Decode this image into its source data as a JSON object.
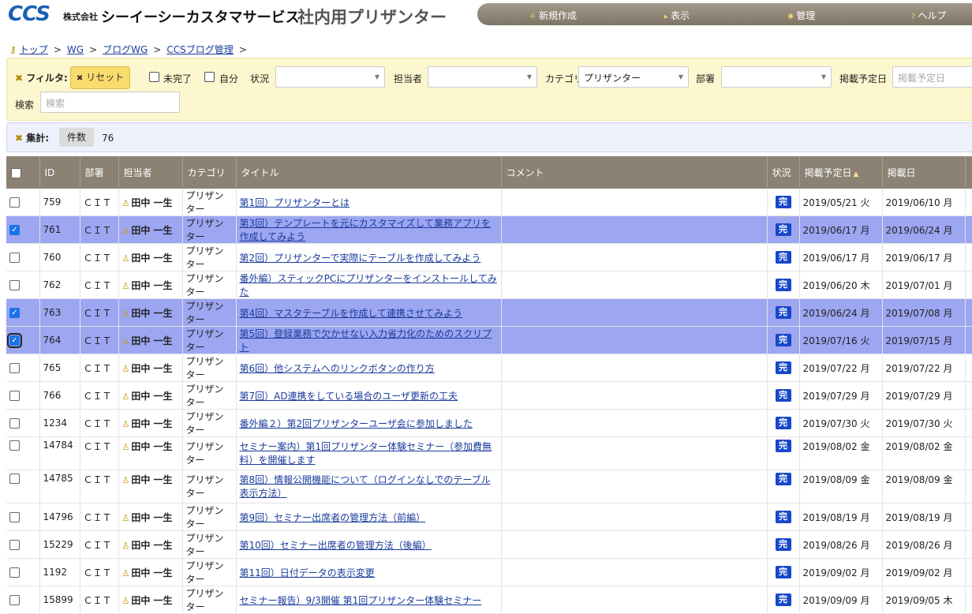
{
  "header": {
    "logo": "CCS",
    "company_prefix": "株式会社",
    "company_name": "シーイーシーカスタマサービス",
    "app_title": "社内用プリザンター",
    "nav": [
      {
        "label": "新規作成",
        "icon": "plus-icon"
      },
      {
        "label": "表示",
        "icon": "arrow-right-icon"
      },
      {
        "label": "管理",
        "icon": "gear-icon"
      },
      {
        "label": "ヘルプ",
        "icon": "question-icon"
      }
    ]
  },
  "breadcrumb": [
    "トップ",
    "WG",
    "ブログWG",
    "CCSブログ管理"
  ],
  "filter": {
    "label": "フィルタ:",
    "reset_label": "リセット",
    "incomplete_label": "未完了",
    "mine_label": "自分",
    "status_label": "状況",
    "status_value": "",
    "owner_label": "担当者",
    "owner_value": "",
    "category_label": "カテゴリ",
    "category_value": "プリザンター",
    "dept_label": "部署",
    "dept_value": "",
    "publish_label": "掲載予定日",
    "publish_placeholder": "掲載予定日",
    "search_label": "検索",
    "search_placeholder": "検索"
  },
  "summary": {
    "label": "集計:",
    "count_label": "件数",
    "count_value": "76"
  },
  "table": {
    "columns": [
      "ID",
      "部署",
      "担当者",
      "カテゴリ",
      "タイトル",
      "コメント",
      "状況",
      "掲載予定日",
      "掲載日"
    ],
    "rows": [
      {
        "id": "759",
        "dept": "ＣＩＴ",
        "owner": "田中 一生",
        "cat": "プリザンター",
        "title": "第1回）プリザンターとは",
        "status": "完",
        "plan": "2019/05/21 火",
        "pub": "2019/06/10 月",
        "checked": false,
        "tall": false
      },
      {
        "id": "761",
        "dept": "ＣＩＴ",
        "owner": "田中 一生",
        "cat": "プリザンター",
        "title": "第3回）テンプレートを元にカスタマイズして業務アプリを作成してみよう",
        "status": "完",
        "plan": "2019/06/17 月",
        "pub": "2019/06/24 月",
        "checked": true,
        "tall": false
      },
      {
        "id": "760",
        "dept": "ＣＩＴ",
        "owner": "田中 一生",
        "cat": "プリザンター",
        "title": "第2回）プリザンターで実際にテーブルを作成してみよう",
        "status": "完",
        "plan": "2019/06/17 月",
        "pub": "2019/06/17 月",
        "checked": false,
        "tall": false
      },
      {
        "id": "762",
        "dept": "ＣＩＴ",
        "owner": "田中 一生",
        "cat": "プリザンター",
        "title": "番外編）スティックPCにプリザンターをインストールしてみた",
        "status": "完",
        "plan": "2019/06/20 木",
        "pub": "2019/07/01 月",
        "checked": false,
        "tall": false
      },
      {
        "id": "763",
        "dept": "ＣＩＴ",
        "owner": "田中 一生",
        "cat": "プリザンター",
        "title": "第4回）マスタテーブルを作成して連携させてみよう",
        "status": "完",
        "plan": "2019/06/24 月",
        "pub": "2019/07/08 月",
        "checked": true,
        "tall": false
      },
      {
        "id": "764",
        "dept": "ＣＩＴ",
        "owner": "田中 一生",
        "cat": "プリザンター",
        "title": "第5回）登録業務で欠かせない入力省力化のためのスクリプト",
        "status": "完",
        "plan": "2019/07/16 火",
        "pub": "2019/07/15 月",
        "checked": true,
        "tall": false
      },
      {
        "id": "765",
        "dept": "ＣＩＴ",
        "owner": "田中 一生",
        "cat": "プリザンター",
        "title": "第6回）他システムへのリンクボタンの作り方",
        "status": "完",
        "plan": "2019/07/22 月",
        "pub": "2019/07/22 月",
        "checked": false,
        "tall": false
      },
      {
        "id": "766",
        "dept": "ＣＩＴ",
        "owner": "田中 一生",
        "cat": "プリザンター",
        "title": "第7回）AD連携をしている場合のユーザ更新の工夫",
        "status": "完",
        "plan": "2019/07/29 月",
        "pub": "2019/07/29 月",
        "checked": false,
        "tall": false
      },
      {
        "id": "1234",
        "dept": "ＣＩＴ",
        "owner": "田中 一生",
        "cat": "プリザンター",
        "title": "番外編２）第2回プリザンターユーザ会に参加しました",
        "status": "完",
        "plan": "2019/07/30 火",
        "pub": "2019/07/30 火",
        "checked": false,
        "tall": false
      },
      {
        "id": "14784",
        "dept": "ＣＩＴ",
        "owner": "田中 一生",
        "cat": "プリザンター",
        "title": "セミナー案内）第1回プリザンター体験セミナー（参加費無料）を開催します",
        "status": "完",
        "plan": "2019/08/02 金",
        "pub": "2019/08/02 金",
        "checked": false,
        "tall": true
      },
      {
        "id": "14785",
        "dept": "ＣＩＴ",
        "owner": "田中 一生",
        "cat": "プリザンター",
        "title": "第8回）情報公開機能について（ログインなしでのテーブル表示方法）",
        "status": "完",
        "plan": "2019/08/09 金",
        "pub": "2019/08/09 金",
        "checked": false,
        "tall": true
      },
      {
        "id": "14796",
        "dept": "ＣＩＴ",
        "owner": "田中 一生",
        "cat": "プリザンター",
        "title": "第9回）セミナー出席者の管理方法（前編）",
        "status": "完",
        "plan": "2019/08/19 月",
        "pub": "2019/08/19 月",
        "checked": false,
        "tall": false
      },
      {
        "id": "15229",
        "dept": "ＣＩＴ",
        "owner": "田中 一生",
        "cat": "プリザンター",
        "title": "第10回）セミナー出席者の管理方法（後編）",
        "status": "完",
        "plan": "2019/08/26 月",
        "pub": "2019/08/26 月",
        "checked": false,
        "tall": false
      },
      {
        "id": "1192",
        "dept": "ＣＩＴ",
        "owner": "田中 一生",
        "cat": "プリザンター",
        "title": "第11回）日付データの表示変更",
        "status": "完",
        "plan": "2019/09/02 月",
        "pub": "2019/09/02 月",
        "checked": false,
        "tall": false
      },
      {
        "id": "15899",
        "dept": "ＣＩＴ",
        "owner": "田中 一生",
        "cat": "プリザンター",
        "title": "セミナー報告）9/3開催 第1回プリザンター体験セミナー",
        "status": "完",
        "plan": "2019/09/09 月",
        "pub": "2019/09/05 木",
        "checked": false,
        "tall": false
      }
    ]
  }
}
